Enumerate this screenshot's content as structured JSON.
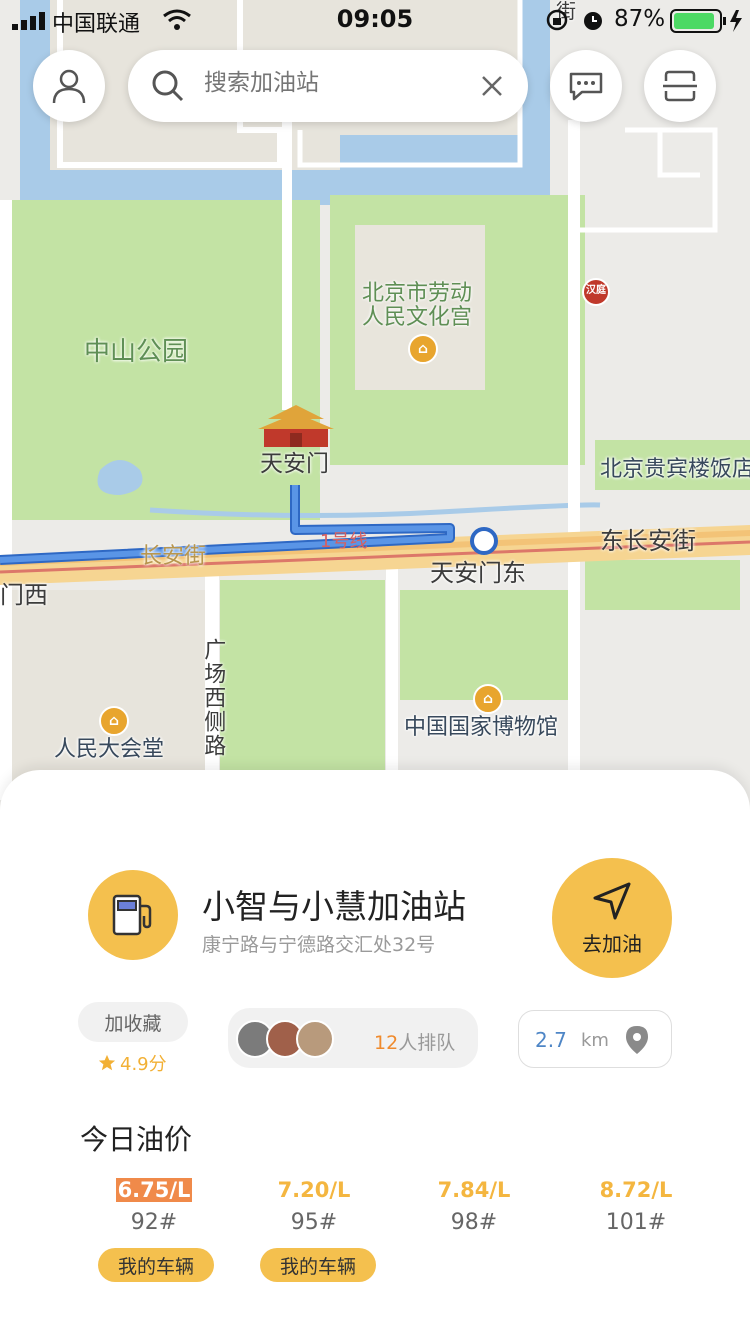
{
  "status_bar": {
    "carrier": "中国联通",
    "time": "09:05",
    "battery": "87%"
  },
  "search": {
    "placeholder": "搜索加油站"
  },
  "map": {
    "labels": {
      "zhongshan_park": "中山公园",
      "labor_palace": "北京市劳动\n人民文化宫",
      "tiananmen": "天安门",
      "guibin_hotel": "北京贵宾楼饭店",
      "changan_street": "长安街",
      "east_changan": "东长安街",
      "line1": "1号线",
      "tiananmen_east": "天安门东",
      "tiananmen_west": "门西",
      "guangchang_road": "广场西侧路",
      "great_hall": "人民大会堂",
      "national_museum": "中国国家博物馆",
      "street_top": "街",
      "metro_badge": "汉庭"
    }
  },
  "station": {
    "name": "小智与小慧加油站",
    "address": "康宁路与宁德路交汇处32号",
    "go_label": "去加油",
    "favorite_label": "加收藏",
    "rating": "4.9分",
    "queue_count": "12",
    "queue_suffix": "人排队",
    "distance_value": "2.7",
    "distance_unit": "km"
  },
  "prices": {
    "title": "今日油价",
    "items": [
      {
        "price": "6.75/L",
        "grade": "92#",
        "tag": "我的车辆",
        "highlighted": true
      },
      {
        "price": "7.20/L",
        "grade": "95#",
        "tag": "我的车辆",
        "highlighted": false
      },
      {
        "price": "7.84/L",
        "grade": "98#",
        "tag": "",
        "highlighted": false
      },
      {
        "price": "8.72/L",
        "grade": "101#",
        "tag": "",
        "highlighted": false
      }
    ]
  },
  "colors": {
    "accent": "#f4c04e",
    "price_text": "#f4b640",
    "price_highlight": "#f08a4a",
    "distance": "#4e86c6",
    "route": "#3f7fd6"
  },
  "icons": {
    "profile": "user-icon",
    "search": "search-icon",
    "clear": "close-icon",
    "message": "chat-icon",
    "scan": "scan-icon",
    "station": "fuel-pump-icon",
    "navigate": "navigation-arrow-icon",
    "location": "location-pin-icon",
    "star": "star-icon"
  }
}
